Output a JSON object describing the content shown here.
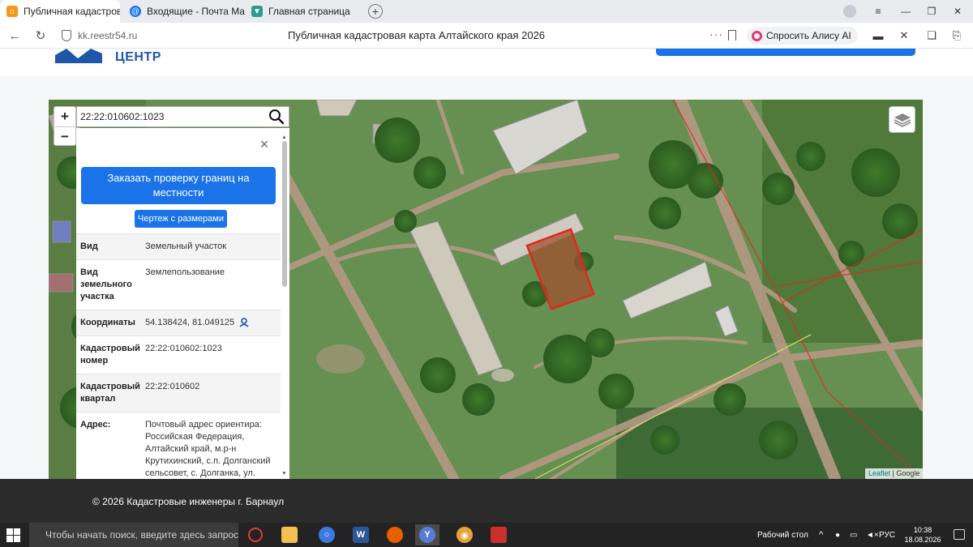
{
  "browser": {
    "tabs": [
      {
        "label": "Публичная кадастров",
        "close": "×",
        "active": true
      },
      {
        "label": "Входящие - Почта Mail",
        "active": false
      },
      {
        "label": "Главная страница",
        "active": false
      }
    ],
    "new_tab": "+",
    "url": "kk.reestr54.ru",
    "page_title": "Публичная кадастровая карта Алтайского края 2026",
    "alice_label": "Спросить Алису AI",
    "more": "···"
  },
  "site": {
    "logo_text": "ЦЕНТР"
  },
  "map": {
    "zoom_in": "+",
    "zoom_out": "−",
    "search_value": "22:22:010602:1023",
    "attribution_leaflet": "Leaflet",
    "attribution_sep": " | ",
    "attribution_google": "Google"
  },
  "panel": {
    "close": "×",
    "order_button": "Заказать проверку границ на местности",
    "drawing_button": "Чертеж с размерами",
    "rows": [
      {
        "key": "Вид",
        "value": "Земельный участок"
      },
      {
        "key": "Вид земельного участка",
        "value": "Землепользование"
      },
      {
        "key": "Координаты",
        "value": "54.138424, 81.049125"
      },
      {
        "key": "Кадастровый номер",
        "value": "22:22:010602:1023"
      },
      {
        "key": "Кадастровый квартал",
        "value": "22:22:010602"
      },
      {
        "key": "Адрес:",
        "value": "Почтовый адрес ориентира: Российская Федерация, Алтайский край, м.р-н Крутихинский, с.п. Долганский сельсовет, с. Долганка, ул."
      }
    ]
  },
  "footer": {
    "text": "© 2026 Кадастровые инженеры г. Барнаул"
  },
  "taskbar": {
    "search_placeholder": "Чтобы начать поиск, введите здесь запрос",
    "desktop_label": "Рабочий стол",
    "lang": "РУС",
    "time": "10:38",
    "date": "18.08.2026"
  },
  "colors": {
    "accent": "#1a73e8",
    "parcel_outline": "#e8231e",
    "footer_bg": "#2b2b2b"
  }
}
